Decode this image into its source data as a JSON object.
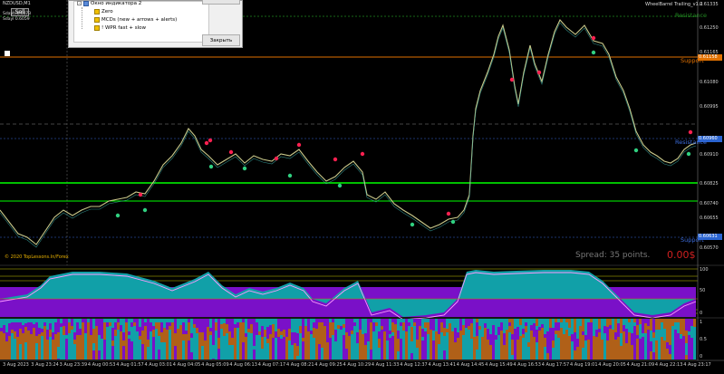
{
  "chart": {
    "symbol": "NZDUSD,M1",
    "sell_label": "Sell",
    "sdaily_line1": "Sdayh 0.6073",
    "sdaily_line2": "Sdayl 0.6059",
    "indicator_title": "WheelBarrel Trailing_v1.2",
    "copyright": "© 2020 TopLessons.In/Forex",
    "spread_text": "Spread: 35 points.",
    "profit_text": "0.00$"
  },
  "levels": {
    "resistance": "Resistance",
    "support1": "Support",
    "resistance2": "Resistance",
    "support2": "Support"
  },
  "price_axis": [
    "0.61335",
    "0.61250",
    "0.61165",
    "0.61080",
    "0.60995",
    "0.60910",
    "0.60825",
    "0.60740",
    "0.60655",
    "0.60570"
  ],
  "price_boxes": {
    "orange": "0.61158",
    "blue": "0.60960",
    "blue2": "0.60631"
  },
  "indicator_axis": [
    "100",
    "50",
    "0"
  ],
  "indicator2_axis": [
    "1",
    "0.5",
    "0"
  ],
  "time_axis": [
    "3 Aug 2023",
    "3 Aug 23:24",
    "3 Aug 23:39",
    "4 Aug 00:53",
    "4 Aug 01:57",
    "4 Aug 03:01",
    "4 Aug 04:05",
    "4 Aug 05:09",
    "4 Aug 06:13",
    "4 Aug 07:17",
    "4 Aug 08:21",
    "4 Aug 09:25",
    "4 Aug 10:29",
    "4 Aug 11:33",
    "4 Aug 12:37",
    "4 Aug 13:41",
    "4 Aug 14:45",
    "4 Aug 15:49",
    "4 Aug 16:53",
    "4 Aug 17:57",
    "4 Aug 19:01",
    "4 Aug 20:05",
    "4 Aug 21:09",
    "4 Aug 22:13",
    "4 Aug 23:17"
  ],
  "dialog": {
    "tree_root": "Окно индикатора 2",
    "items": [
      "Zero",
      "MCDs (new + arrows + alerts)",
      "! WPR fast + slow"
    ],
    "close_button": "Закрыть"
  },
  "colors": {
    "green_line": "#00ff00",
    "orange_line": "#e07000",
    "teal_fill": "#11a0a8",
    "purple_fill": "#7a10c8",
    "brown_fill": "#b06018"
  }
}
